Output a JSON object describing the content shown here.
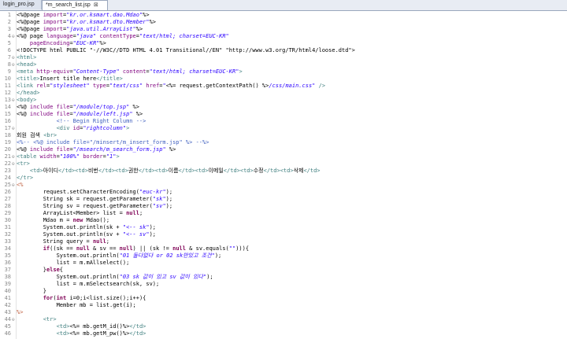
{
  "tabs": [
    {
      "label": "login_pro.jsp"
    },
    {
      "label": "*m_search_list.jsp",
      "close": "⊠"
    }
  ],
  "lines": [
    {
      "n": "1",
      "f": "",
      "h": "&lt;%@page <span class='at'>import</span>=<span class='st'>\"kr.or.ksmart.dao.Mdao\"</span>%&gt;"
    },
    {
      "n": "2",
      "f": "",
      "h": "&lt;%@page <span class='at'>import</span>=<span class='st'>\"kr.or.ksmart.dto.Member\"</span>%&gt;"
    },
    {
      "n": "3",
      "f": "",
      "h": "&lt;%@page <span class='at'>import</span>=<span class='st'>\"java.util.ArrayList\"</span>%&gt;"
    },
    {
      "n": "4",
      "f": "⊖",
      "h": "&lt;%@ page <span class='at'>language</span>=<span class='st'>\"java\"</span> <span class='at'>contentType</span>=<span class='st'>\"text/html; charset=EUC-KR\"</span>"
    },
    {
      "n": "5",
      "f": "",
      "h": "    <span class='at'>pageEncoding</span>=<span class='st'>\"EUC-KR\"</span>%&gt;"
    },
    {
      "n": "6",
      "f": "",
      "h": "&lt;!DOCTYPE html PUBLIC \"-//W3C//DTD HTML 4.01 Transitional//EN\" \"http://www.w3.org/TR/html4/loose.dtd\"&gt;"
    },
    {
      "n": "7",
      "f": "⊖",
      "h": "<span class='tg'>&lt;html&gt;</span>"
    },
    {
      "n": "8",
      "f": "⊖",
      "h": "<span class='tg'>&lt;head&gt;</span>"
    },
    {
      "n": "9",
      "f": "",
      "h": "<span class='tg'>&lt;meta</span> <span class='at'>http-equiv</span>=<span class='st'>\"Content-Type\"</span> <span class='at'>content</span>=<span class='st'>\"text/html; charset=EUC-KR\"</span><span class='tg'>&gt;</span>"
    },
    {
      "n": "10",
      "f": "",
      "h": "<span class='tg'>&lt;title&gt;</span>Insert title here<span class='tg'>&lt;/title&gt;</span>"
    },
    {
      "n": "11",
      "f": "",
      "h": "<span class='tg'>&lt;link</span> <span class='at'>rel</span>=<span class='st'>\"stylesheet\"</span> <span class='at'>type</span>=<span class='st'>\"text/css\"</span> <span class='at'>href</span>=<span class='st'>\"</span>&lt;%= request.getContextPath() %&gt;<span class='st'>/css/main.css\"</span> <span class='tg'>/&gt;</span>"
    },
    {
      "n": "12",
      "f": "",
      "h": "<span class='tg'>&lt;/head&gt;</span>"
    },
    {
      "n": "13",
      "f": "⊖",
      "h": "<span class='tg'>&lt;body&gt;</span>"
    },
    {
      "n": "14",
      "f": "",
      "h": "&lt;%@ <span class='at'>include</span> <span class='at'>file</span>=<span class='st'>\"/module/top.jsp\"</span> %&gt;"
    },
    {
      "n": "15",
      "f": "",
      "h": "&lt;%@ <span class='at'>include</span> <span class='at'>file</span>=<span class='st'>\"/module/left.jsp\"</span> %&gt;"
    },
    {
      "n": "16",
      "f": "",
      "h": "            <span class='cm'>&lt;!-- Begin Right Column --&gt;</span>"
    },
    {
      "n": "17",
      "f": "⊖",
      "h": "            <span class='tg'>&lt;div</span> <span class='at'>id</span>=<span class='st'>\"rightcolumn\"</span><span class='tg'>&gt;</span>"
    },
    {
      "n": "18",
      "f": "",
      "h": "회원 검색 <span class='tg'>&lt;br&gt;</span>"
    },
    {
      "n": "19",
      "f": "",
      "h": "<span class='cm'>&lt;%-- &lt;%@ include file=\"/minsert/m_insert_form.jsp\" %&gt; --%&gt;</span>"
    },
    {
      "n": "20",
      "f": "",
      "h": "&lt;%@ <span class='at'>include</span> <span class='at'>file</span>=<span class='st'>\"/msearch/m_search_form.jsp\"</span> %&gt;"
    },
    {
      "n": "21",
      "f": "⊖",
      "h": "<span class='tg'>&lt;table</span> <span class='at'>width</span>=<span class='st'>\"100%\"</span> <span class='at'>border</span>=<span class='st'>\"1\"</span><span class='tg'>&gt;</span>"
    },
    {
      "n": "22",
      "f": "⊖",
      "h": "<span class='tg'>&lt;tr&gt;</span>"
    },
    {
      "n": "23",
      "f": "",
      "h": "    <span class='tg'>&lt;td&gt;</span>아이디<span class='tg'>&lt;/td&gt;&lt;td&gt;</span>비번<span class='tg'>&lt;/td&gt;&lt;td&gt;</span>권한<span class='tg'>&lt;/td&gt;&lt;td&gt;</span>이름<span class='tg'>&lt;/td&gt;&lt;td&gt;</span>이메일<span class='tg'>&lt;/td&gt;&lt;td&gt;</span>수정<span class='tg'>&lt;/td&gt;&lt;td&gt;</span>삭제<span class='tg'>&lt;/td&gt;</span>"
    },
    {
      "n": "24",
      "f": "",
      "h": "<span class='tg'>&lt;/tr&gt;</span>"
    },
    {
      "n": "25",
      "f": "⊖",
      "h": "<span class='jsp'>&lt;%</span>"
    },
    {
      "n": "26",
      "f": "",
      "h": "        request.setCharacterEncoding(<span class='st'>\"euc-kr\"</span>);"
    },
    {
      "n": "27",
      "f": "",
      "h": "        String sk = request.getParameter(<span class='st'>\"sk\"</span>);"
    },
    {
      "n": "28",
      "f": "",
      "h": "        String sv = request.getParameter(<span class='st'>\"sv\"</span>);"
    },
    {
      "n": "29",
      "f": "",
      "h": "        ArrayList&lt;Member&gt; list = <span class='k'>null</span>;"
    },
    {
      "n": "30",
      "f": "",
      "h": "        Mdao m = <span class='k'>new</span> Mdao();"
    },
    {
      "n": "31",
      "f": "",
      "h": "        System.out.println(sk + <span class='st'>\"&lt;-- sk\"</span>);"
    },
    {
      "n": "32",
      "f": "",
      "h": "        System.out.println(sv + <span class='st'>\"&lt;-- sv\"</span>);"
    },
    {
      "n": "33",
      "f": "",
      "h": "        String query = <span class='k'>null</span>;"
    },
    {
      "n": "34",
      "f": "",
      "h": "        <span class='k'>if</span>((sk == <span class='k'>null</span> &amp; sv == <span class='k'>null</span>) || (sk != <span class='k'>null</span> &amp; sv.equals(<span class='st'>\"\"</span>))){"
    },
    {
      "n": "35",
      "f": "",
      "h": "            System.out.println(<span class='st'>\"01 둘다없다 or 02 sk만있고 조건\"</span>);"
    },
    {
      "n": "36",
      "f": "",
      "h": "            list = m.mAllselect();"
    },
    {
      "n": "37",
      "f": "",
      "h": "        }<span class='k'>else</span>{"
    },
    {
      "n": "38",
      "f": "",
      "h": "            System.out.println(<span class='st'>\"03 sk 값이 있고 sv 값이 있다\"</span>);"
    },
    {
      "n": "39",
      "f": "",
      "h": "            list = m.mSelectsearch(sk, sv);"
    },
    {
      "n": "40",
      "f": "",
      "h": "        }"
    },
    {
      "n": "41",
      "f": "",
      "h": "        <span class='k'>for</span>(<span class='k'>int</span> i=0;i&lt;list.size();i++){"
    },
    {
      "n": "42",
      "f": "",
      "h": "            Member mb = list.get(i);"
    },
    {
      "n": "43",
      "f": "",
      "h": "<span class='jsp'>%&gt;</span>"
    },
    {
      "n": "44",
      "f": "⊖",
      "h": "        <span class='tg'>&lt;tr&gt;</span>"
    },
    {
      "n": "45",
      "f": "",
      "h": "            <span class='tg'>&lt;td&gt;</span>&lt;%= mb.getM_id()%&gt;<span class='tg'>&lt;/td&gt;</span>"
    },
    {
      "n": "46",
      "f": "",
      "h": "            <span class='tg'>&lt;td&gt;</span>&lt;%= mb.getM_pw()%&gt;<span class='tg'>&lt;/td&gt;</span>"
    }
  ]
}
